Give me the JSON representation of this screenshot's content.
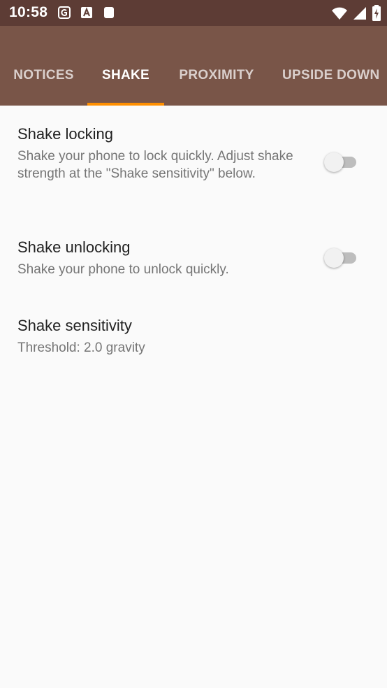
{
  "status_bar": {
    "time": "10:58",
    "left_icons": [
      "g-app-icon",
      "a-app-icon",
      "square-app-icon"
    ],
    "right_icons": [
      "wifi-icon",
      "signal-icon",
      "battery-icon"
    ],
    "background": "#5d3c35"
  },
  "tabs": [
    {
      "label": "NOTICES",
      "selected": false
    },
    {
      "label": "SHAKE",
      "selected": true
    },
    {
      "label": "PROXIMITY",
      "selected": false
    },
    {
      "label": "UPSIDE DOWN",
      "selected": false
    }
  ],
  "colors": {
    "appbar": "#795548",
    "indicator": "#ff8f00",
    "background": "#fafafa"
  },
  "preferences": [
    {
      "title": "Shake locking",
      "summary": "Shake your phone to lock quickly. Adjust shake strength at the \"Shake sensitivity\" below.",
      "switch": "off"
    },
    {
      "title": "Shake unlocking",
      "summary": "Shake your phone to unlock quickly.",
      "switch": "off"
    },
    {
      "title": "Shake sensitivity",
      "summary": "Threshold: 2.0 gravity"
    }
  ]
}
